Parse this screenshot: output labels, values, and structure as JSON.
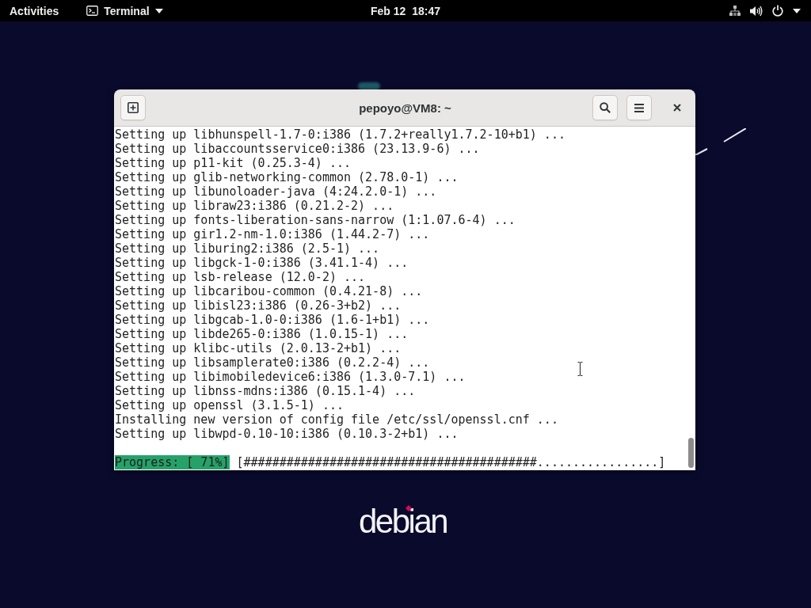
{
  "top_bar": {
    "activities": "Activities",
    "app_menu": "Terminal",
    "clock": "Feb 12  18:47"
  },
  "window": {
    "title": "pepoyo@VM8: ~",
    "lines": [
      "Setting up libhunspell-1.7-0:i386 (1.7.2+really1.7.2-10+b1) ...",
      "Setting up libaccountsservice0:i386 (23.13.9-6) ...",
      "Setting up p11-kit (0.25.3-4) ...",
      "Setting up glib-networking-common (2.78.0-1) ...",
      "Setting up libunoloader-java (4:24.2.0-1) ...",
      "Setting up libraw23:i386 (0.21.2-2) ...",
      "Setting up fonts-liberation-sans-narrow (1:1.07.6-4) ...",
      "Setting up gir1.2-nm-1.0:i386 (1.44.2-7) ...",
      "Setting up liburing2:i386 (2.5-1) ...",
      "Setting up libgck-1-0:i386 (3.41.1-4) ...",
      "Setting up lsb-release (12.0-2) ...",
      "Setting up libcaribou-common (0.4.21-8) ...",
      "Setting up libisl23:i386 (0.26-3+b2) ...",
      "Setting up libgcab-1.0-0:i386 (1.6-1+b1) ...",
      "Setting up libde265-0:i386 (1.0.15-1) ...",
      "Setting up klibc-utils (2.0.13-2+b1) ...",
      "Setting up libsamplerate0:i386 (0.2.2-4) ...",
      "Setting up libimobiledevice6:i386 (1.3.0-7.1) ...",
      "Setting up libnss-mdns:i386 (0.15.1-4) ...",
      "Setting up openssl (3.1.5-1) ...",
      "Installing new version of config file /etc/ssl/openssl.cnf ...",
      "Setting up libwpd-0.10-10:i386 (0.10.3-2+b1) ..."
    ],
    "progress": {
      "label": "Progress: [ 71%]",
      "bar": "[#########################################.................]"
    }
  },
  "wallpaper": {
    "logo": "debian"
  }
}
